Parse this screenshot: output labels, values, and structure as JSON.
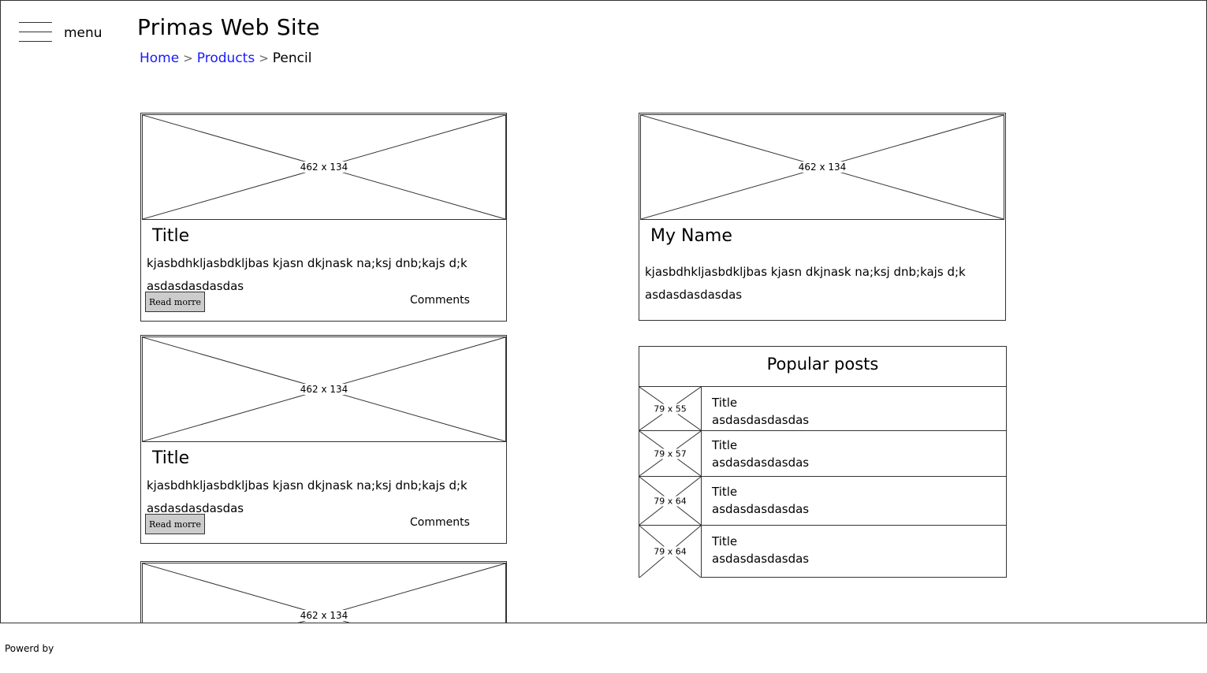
{
  "header": {
    "menu_label": "menu",
    "site_title": "Primas Web Site",
    "breadcrumb": [
      {
        "label": "Home"
      },
      {
        "label": "Products"
      },
      {
        "label": "Pencil"
      }
    ],
    "breadcrumb_separator": ">"
  },
  "posts": [
    {
      "image_label": "462 x 134",
      "title": "Title",
      "text": "kjasbdhkljasbdkljbas kjasn dkjnask na;ksj dnb;kajs d;k asdasdasdasdas",
      "read_more_label": "Read morre",
      "comments_label": "Comments"
    },
    {
      "image_label": "462 x 134",
      "title": "Title",
      "text": "kjasbdhkljasbdkljbas kjasn dkjnask na;ksj dnb;kajs d;k asdasdasdasdas",
      "read_more_label": "Read morre",
      "comments_label": "Comments"
    },
    {
      "image_label": "462 x 134"
    }
  ],
  "profile": {
    "image_label": "462 x 134",
    "name": "My Name",
    "text": "kjasbdhkljasbdkljbas kjasn dkjnask na;ksj dnb;kajs d;k asdasdasdasdas"
  },
  "popular_posts": {
    "title": "Popular posts",
    "items": [
      {
        "image_label": "79 x 55",
        "title": "Title",
        "text": "asdasdasdasdas"
      },
      {
        "image_label": "79 x 57",
        "title": "Title",
        "text": "asdasdasdasdas"
      },
      {
        "image_label": "79 x 64",
        "title": "Title",
        "text": "asdasdasdasdas"
      },
      {
        "image_label": "79 x 64",
        "title": "Title",
        "text": "asdasdasdasdas"
      }
    ]
  },
  "footer": {
    "text": "Powerd by"
  }
}
